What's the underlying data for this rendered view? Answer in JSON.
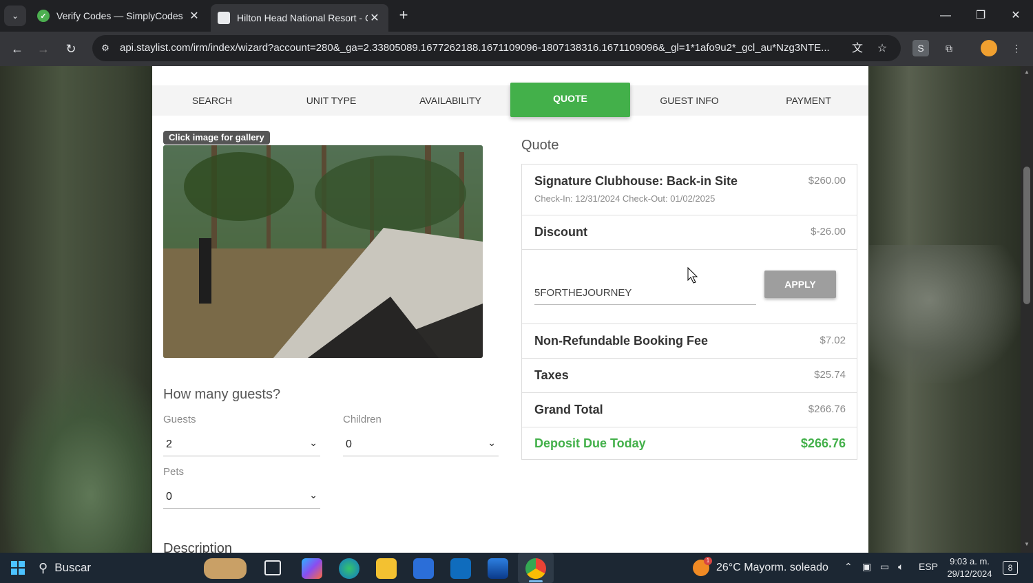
{
  "browser": {
    "tabs": [
      {
        "title": "Verify Codes — SimplyCodes"
      },
      {
        "title": "Hilton Head National Resort - C"
      }
    ],
    "url": "api.staylist.com/irm/index/wizard?account=280&_ga=2.33805089.1677262188.1671109096-1807138316.1671109096&_gl=1*1afo9u2*_gcl_au*Nzg3NTE..."
  },
  "steps": [
    "SEARCH",
    "UNIT TYPE",
    "AVAILABILITY",
    "QUOTE",
    "GUEST INFO",
    "PAYMENT"
  ],
  "active_step": "QUOTE",
  "gallery": {
    "tag": "Click image for gallery"
  },
  "guests": {
    "title": "How many guests?",
    "guests_label": "Guests",
    "guests_value": "2",
    "children_label": "Children",
    "children_value": "0",
    "pets_label": "Pets",
    "pets_value": "0"
  },
  "description_title": "Description",
  "quote": {
    "title": "Quote",
    "site_name": "Signature Clubhouse: Back-in Site",
    "site_price": "$260.00",
    "dates": "Check-In: 12/31/2024 Check-Out: 01/02/2025",
    "discount_label": "Discount",
    "discount_amount": "$-26.00",
    "promo_code": "5FORTHEJOURNEY",
    "apply_label": "APPLY",
    "fee_label": "Non-Refundable Booking Fee",
    "fee_amount": "$7.02",
    "taxes_label": "Taxes",
    "taxes_amount": "$25.74",
    "total_label": "Grand Total",
    "total_amount": "$266.76",
    "deposit_label": "Deposit Due Today",
    "deposit_amount": "$266.76"
  },
  "taskbar": {
    "search": "Buscar",
    "weather": "26°C  Mayorm. soleado",
    "weather_badge": "1",
    "lang": "ESP",
    "time": "9:03 a. m.",
    "date": "29/12/2024",
    "notifications": "8"
  },
  "colors": {
    "accent": "#43b04a",
    "apply_button": "#9e9e9e"
  }
}
